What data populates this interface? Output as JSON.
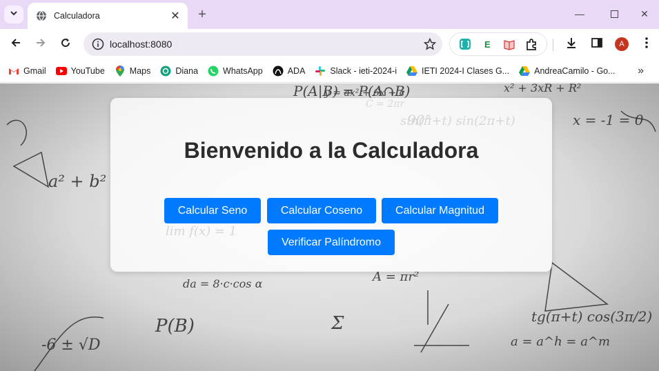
{
  "browser": {
    "tab": {
      "title": "Calculadora"
    },
    "address": {
      "url": "localhost:8080"
    },
    "profile_initial": "A",
    "bookmarks": [
      {
        "label": "Gmail",
        "icon": "gmail-icon"
      },
      {
        "label": "YouTube",
        "icon": "youtube-icon"
      },
      {
        "label": "Maps",
        "icon": "maps-icon"
      },
      {
        "label": "Diana",
        "icon": "chatgpt-icon"
      },
      {
        "label": "WhatsApp",
        "icon": "whatsapp-icon"
      },
      {
        "label": "ADA",
        "icon": "ada-icon"
      },
      {
        "label": "Slack - ieti-2024-i",
        "icon": "slack-icon"
      },
      {
        "label": "IETI 2024-I Clases G...",
        "icon": "drive-icon"
      },
      {
        "label": "AndreaCamilo - Go...",
        "icon": "drive-icon"
      }
    ],
    "colors": {
      "tabstrip": "#e8d9f6",
      "omnibox": "#efe9f3",
      "avatar": "#c4371d"
    }
  },
  "page": {
    "heading": "Bienvenido a la Calculadora",
    "buttons": {
      "sine": "Calcular Seno",
      "cosine": "Calcular Coseno",
      "magnitude": "Calcular Magnitud",
      "palindrome": "Verificar Palíndromo"
    },
    "colors": {
      "button": "#007bff",
      "heading": "#2c2c2c"
    },
    "background_formulas": [
      "P(A|B) = P(A∩B)",
      "x = -1 = 0",
      "a² + b²",
      "lim f(x) = 1",
      "y = ax² + 6x + c",
      "sin(π+t) sin(2π+t)",
      "tg(π+t) cos(3π/2)",
      "a = a^h = a^m",
      "A = πr²",
      "P(B)",
      "C = 2πr",
      "90°",
      "-6 ± √D",
      "Σ",
      "da = 8·c·cos α",
      "x² + 3xR + R²"
    ]
  }
}
